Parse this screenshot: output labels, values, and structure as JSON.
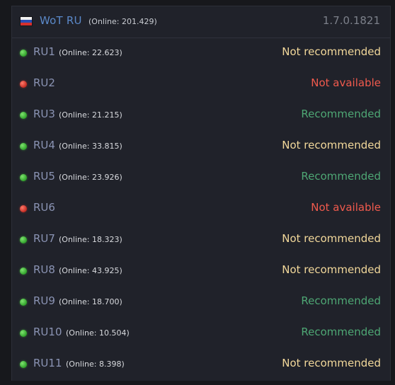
{
  "realm": {
    "name": "WoT RU",
    "online": "(Online: 201.429)",
    "version": "1.7.0.1821",
    "flag_icon": "russia-flag-icon"
  },
  "colors": {
    "recommended": "#4ea774",
    "not_recommended": "#f2d89a",
    "not_available": "#f05a4d",
    "online_dot": "#3cbf36",
    "offline_dot": "#dd3a30",
    "server_name": "#8a93b3",
    "realm_name": "#5b89c9"
  },
  "servers": [
    {
      "name": "RU1",
      "online": "(Online: 22.623)",
      "status": "Not recommended",
      "state": "up",
      "kind": "not"
    },
    {
      "name": "RU2",
      "online": "",
      "status": "Not available",
      "state": "down",
      "kind": "na"
    },
    {
      "name": "RU3",
      "online": "(Online: 21.215)",
      "status": "Recommended",
      "state": "up",
      "kind": "rec"
    },
    {
      "name": "RU4",
      "online": "(Online: 33.815)",
      "status": "Not recommended",
      "state": "up",
      "kind": "not"
    },
    {
      "name": "RU5",
      "online": "(Online: 23.926)",
      "status": "Recommended",
      "state": "up",
      "kind": "rec"
    },
    {
      "name": "RU6",
      "online": "",
      "status": "Not available",
      "state": "down",
      "kind": "na"
    },
    {
      "name": "RU7",
      "online": "(Online: 18.323)",
      "status": "Not recommended",
      "state": "up",
      "kind": "not"
    },
    {
      "name": "RU8",
      "online": "(Online: 43.925)",
      "status": "Not recommended",
      "state": "up",
      "kind": "not"
    },
    {
      "name": "RU9",
      "online": "(Online: 18.700)",
      "status": "Recommended",
      "state": "up",
      "kind": "rec"
    },
    {
      "name": "RU10",
      "online": "(Online: 10.504)",
      "status": "Recommended",
      "state": "up",
      "kind": "rec"
    },
    {
      "name": "RU11",
      "online": "(Online: 8.398)",
      "status": "Not recommended",
      "state": "up",
      "kind": "not"
    }
  ]
}
